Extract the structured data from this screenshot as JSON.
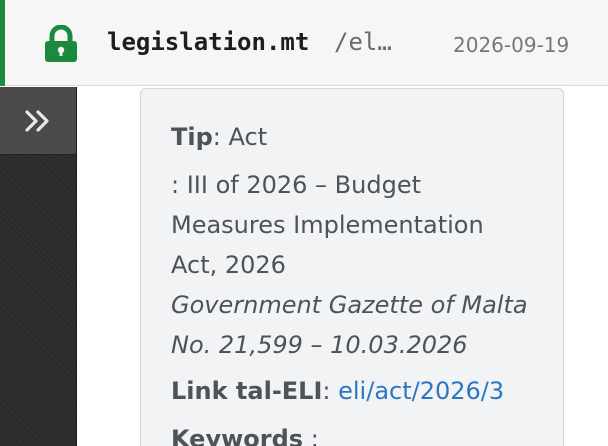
{
  "header": {
    "lock_icon": "lock-icon",
    "domain": "legislation.mt",
    "path": "/el…",
    "date": "2026-09-19",
    "accent_color": "#1c8a3c"
  },
  "sidebar": {
    "expand_icon": "double-chevron-right-icon"
  },
  "tooltip": {
    "tip_label": "Tip",
    "tip_value": ": Act",
    "title_line1": ": III of 2026 – Budget",
    "title_line2": "Measures Implementation",
    "title_line3": "Act, 2026",
    "gazette_line1": "Government Gazette of Malta",
    "gazette_line2": "No. 21,599 – 10.03.2026",
    "eli_label": "Link tal-ELI",
    "eli_sep": ": ",
    "eli_link": "eli/act/2026/3",
    "keywords_label": "Keywords",
    "keywords_sep": " :"
  }
}
